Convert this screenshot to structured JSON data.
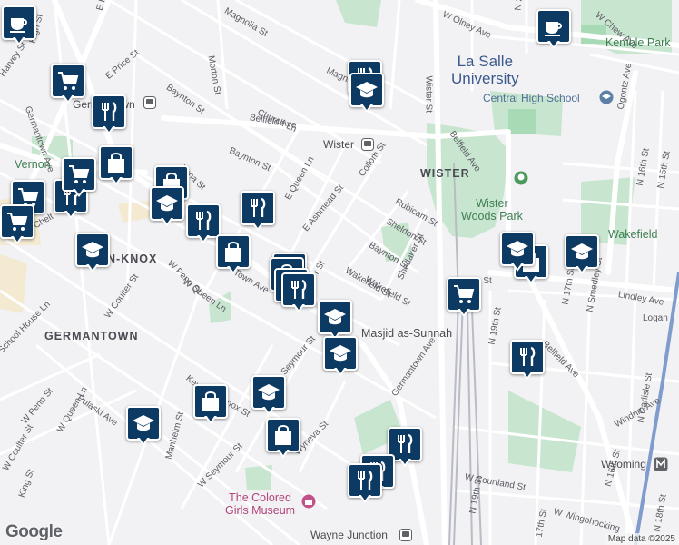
{
  "streets": [
    {
      "t": "High St"
    },
    {
      "t": "E High St"
    },
    {
      "t": "Magnolia St"
    },
    {
      "t": "Morton St"
    },
    {
      "t": "Harvey St"
    },
    {
      "t": "E Price St"
    },
    {
      "t": "Church Ln"
    },
    {
      "t": "Magnolia"
    },
    {
      "t": "Wister St"
    },
    {
      "t": "W Olney Ave"
    },
    {
      "t": "N 20th St"
    },
    {
      "t": "W Chew Ave"
    },
    {
      "t": "Germantown Ave"
    },
    {
      "t": "Baynton St"
    },
    {
      "t": "Belfield Ave"
    },
    {
      "t": "Baynton St"
    },
    {
      "t": "Lena St"
    },
    {
      "t": "E Queen Ln"
    },
    {
      "t": "E Ashmead St"
    },
    {
      "t": "Collom St"
    },
    {
      "t": "Belfield Ave"
    },
    {
      "t": "Ogontz Ave"
    },
    {
      "t": "Rubicam St"
    },
    {
      "t": "Sheldon St"
    },
    {
      "t": "Baynton St"
    },
    {
      "t": "Shedaker St"
    },
    {
      "t": "Wakefield St"
    },
    {
      "t": "Lindley Ave"
    },
    {
      "t": "N 16th St"
    },
    {
      "t": "N 15th St"
    },
    {
      "t": "Logan"
    },
    {
      "t": "W Penn St"
    },
    {
      "t": "W Queen Ln"
    },
    {
      "t": "W Coulter St"
    },
    {
      "t": "School House Ln"
    },
    {
      "t": "Pulaski Ave"
    },
    {
      "t": "W Penn St"
    },
    {
      "t": "W Queen Ln"
    },
    {
      "t": "W Coulter St"
    },
    {
      "t": "King St"
    },
    {
      "t": "Manheim St"
    },
    {
      "t": "W Seymour St"
    },
    {
      "t": "Knox St"
    },
    {
      "t": "Keyser"
    },
    {
      "t": "Seymour St"
    },
    {
      "t": "Wyneva St"
    },
    {
      "t": "Germantown Ave"
    },
    {
      "t": "Windrim Ave"
    },
    {
      "t": "W Courtland St"
    },
    {
      "t": "W Wingohocking"
    },
    {
      "t": "N 19th St"
    },
    {
      "t": "17th St"
    },
    {
      "t": "N 16th St"
    },
    {
      "t": "N Carlisle St"
    },
    {
      "t": "N 17th St"
    },
    {
      "t": "N Smedley St"
    },
    {
      "t": "N 19th St"
    },
    {
      "t": "Belfield Ave"
    },
    {
      "t": "N 18th St"
    },
    {
      "t": "Wakefield St"
    },
    {
      "t": "n St"
    },
    {
      "t": "Town Ave"
    },
    {
      "t": "urst"
    },
    {
      "t": "r St"
    },
    {
      "t": "Chelt"
    }
  ],
  "neighborhoods": {
    "wister": "WISTER",
    "penn_knox": "N-KNOX",
    "germantown": "GERMANTOWN",
    "vernon": "Vernon"
  },
  "labels": {
    "la_salle": "La Salle\nUniversity",
    "central_high": "Central High School",
    "wister_woods": "Wister\nWoods Park",
    "kemble_park": "Kemble Park",
    "wakefield": "Wakefield",
    "masjid": "Masjid as-Sunnah",
    "colored_girls": "The Colored\nGirls Museum",
    "germantown_poi": "Germantown",
    "wister_station": "Wister",
    "wayne_junction": "Wayne Junction",
    "wyoming": "Wyoming",
    "belfield_ave_right": "Belfield Ave",
    "germantown_ave_south": "rmantown Ave",
    "n_20th": "N 20th St"
  },
  "pins": [
    {
      "type": "cafe-icon"
    },
    {
      "type": "cafe-icon"
    },
    {
      "type": "shopping-cart-icon"
    },
    {
      "type": "restaurant-icon"
    },
    {
      "type": "shopping-bag-icon"
    },
    {
      "type": "restaurant-icon"
    },
    {
      "type": "shopping-cart-icon"
    },
    {
      "type": "shopping-cart-icon"
    },
    {
      "type": "restaurant-icon"
    },
    {
      "type": "school-icon"
    },
    {
      "type": "shopping-cart-icon"
    },
    {
      "type": "school-icon"
    },
    {
      "type": "shopping-bag-icon"
    },
    {
      "type": "school-icon"
    },
    {
      "type": "restaurant-icon"
    },
    {
      "type": "restaurant-icon"
    },
    {
      "type": "shopping-bag-icon"
    },
    {
      "type": "school-icon"
    },
    {
      "type": "shopping-bag-icon"
    },
    {
      "type": "shopping-bag-icon"
    },
    {
      "type": "restaurant-icon"
    },
    {
      "type": "school-icon"
    },
    {
      "type": "school-icon"
    },
    {
      "type": "school-icon"
    },
    {
      "type": "shopping-bag-icon"
    },
    {
      "type": "school-icon"
    },
    {
      "type": "shopping-bag-icon"
    },
    {
      "type": "restaurant-icon"
    },
    {
      "type": "restaurant-icon"
    },
    {
      "type": "restaurant-icon"
    },
    {
      "type": "shopping-cart-icon"
    },
    {
      "type": "restaurant-icon"
    },
    {
      "type": "shopping-bag-icon"
    },
    {
      "type": "school-icon"
    },
    {
      "type": "school-icon"
    }
  ],
  "attribution": {
    "google": "Google",
    "map_data": "Map data ©2025"
  }
}
